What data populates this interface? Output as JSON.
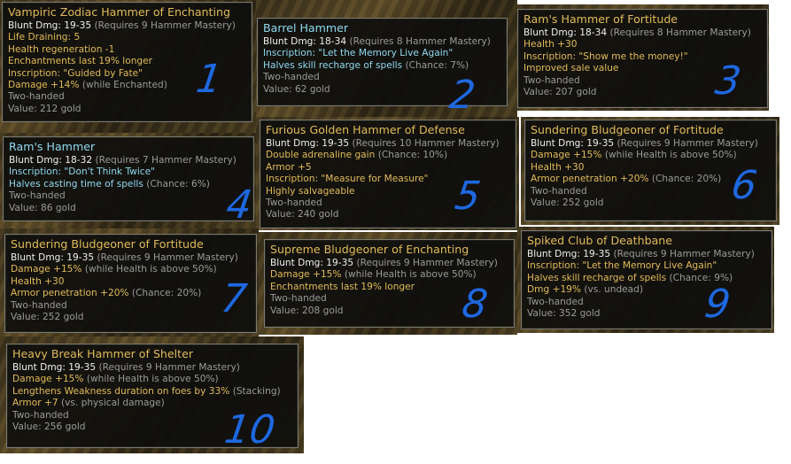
{
  "tooltips": [
    {
      "name": "Vampiric Zodiac Hammer of Enchanting",
      "lines": [
        {
          "parts": [
            {
              "t": "Blunt Dmg: 19-35 ",
              "c": "white"
            },
            {
              "t": "(Requires 9 Hammer Mastery)",
              "c": "gray"
            }
          ]
        },
        {
          "parts": [
            {
              "t": "Life Draining: 5",
              "c": "gold"
            }
          ]
        },
        {
          "parts": [
            {
              "t": "Health regeneration -1",
              "c": "gold"
            }
          ]
        },
        {
          "parts": [
            {
              "t": "Enchantments last 19% longer",
              "c": "gold"
            }
          ]
        },
        {
          "parts": [
            {
              "t": "Inscription: \"Guided by Fate\"",
              "c": "gold"
            }
          ]
        },
        {
          "parts": [
            {
              "t": "Damage +14% ",
              "c": "gold"
            },
            {
              "t": "(while Enchanted)",
              "c": "gray"
            }
          ]
        },
        {
          "parts": [
            {
              "t": "Two-handed",
              "c": "gray"
            }
          ]
        },
        {
          "parts": [
            {
              "t": "Value: 212 gold",
              "c": "gray"
            }
          ]
        }
      ]
    },
    {
      "name": "Barrel Hammer",
      "lines": [
        {
          "parts": [
            {
              "t": "Blunt Dmg: 18-34 ",
              "c": "white"
            },
            {
              "t": "(Requires 8 Hammer Mastery)",
              "c": "gray"
            }
          ]
        },
        {
          "parts": [
            {
              "t": "Inscription: \"Let the Memory Live Again\"",
              "c": "cyan"
            }
          ]
        },
        {
          "parts": [
            {
              "t": "Halves skill recharge of spells ",
              "c": "cyan"
            },
            {
              "t": "(Chance: 7%)",
              "c": "gray"
            }
          ]
        },
        {
          "parts": [
            {
              "t": "Two-handed",
              "c": "gray"
            }
          ]
        },
        {
          "parts": [
            {
              "t": "Value: 62 gold",
              "c": "gray"
            }
          ]
        }
      ]
    },
    {
      "name": "Ram's Hammer of Fortitude",
      "lines": [
        {
          "parts": [
            {
              "t": "Blunt Dmg: 18-34 ",
              "c": "white"
            },
            {
              "t": "(Requires 8 Hammer Mastery)",
              "c": "gray"
            }
          ]
        },
        {
          "parts": [
            {
              "t": "Health +30",
              "c": "gold"
            }
          ]
        },
        {
          "parts": [
            {
              "t": "Inscription: \"Show me the money!\"",
              "c": "gold"
            }
          ]
        },
        {
          "parts": [
            {
              "t": "Improved sale value",
              "c": "gold"
            }
          ]
        },
        {
          "parts": [
            {
              "t": "Two-handed",
              "c": "gray"
            }
          ]
        },
        {
          "parts": [
            {
              "t": "Value: 207 gold",
              "c": "gray"
            }
          ]
        }
      ]
    },
    {
      "name": "Ram's Hammer",
      "lines": [
        {
          "parts": [
            {
              "t": "Blunt Dmg: 18-32 ",
              "c": "white"
            },
            {
              "t": "(Requires 7 Hammer Mastery)",
              "c": "gray"
            }
          ]
        },
        {
          "parts": [
            {
              "t": "Inscription: \"Don't Think Twice\"",
              "c": "cyan"
            }
          ]
        },
        {
          "parts": [
            {
              "t": "Halves casting time of spells ",
              "c": "cyan"
            },
            {
              "t": "(Chance: 6%)",
              "c": "gray"
            }
          ]
        },
        {
          "parts": [
            {
              "t": "Two-handed",
              "c": "gray"
            }
          ]
        },
        {
          "parts": [
            {
              "t": "Value: 86 gold",
              "c": "gray"
            }
          ]
        }
      ]
    },
    {
      "name": "Furious Golden Hammer of Defense",
      "lines": [
        {
          "parts": [
            {
              "t": "Blunt Dmg: 19-35 ",
              "c": "white"
            },
            {
              "t": "(Requires 10 Hammer Mastery)",
              "c": "gray"
            }
          ]
        },
        {
          "parts": [
            {
              "t": "Double adrenaline gain ",
              "c": "gold"
            },
            {
              "t": "(Chance: 10%)",
              "c": "gray"
            }
          ]
        },
        {
          "parts": [
            {
              "t": "Armor +5",
              "c": "gold"
            }
          ]
        },
        {
          "parts": [
            {
              "t": "Inscription: \"Measure for Measure\"",
              "c": "gold"
            }
          ]
        },
        {
          "parts": [
            {
              "t": "Highly salvageable",
              "c": "gold"
            }
          ]
        },
        {
          "parts": [
            {
              "t": "Two-handed",
              "c": "gray"
            }
          ]
        },
        {
          "parts": [
            {
              "t": "Value: 240 gold",
              "c": "gray"
            }
          ]
        }
      ]
    },
    {
      "name": "Sundering Bludgeoner of Fortitude",
      "lines": [
        {
          "parts": [
            {
              "t": "Blunt Dmg: 19-35 ",
              "c": "white"
            },
            {
              "t": "(Requires 9 Hammer Mastery)",
              "c": "gray"
            }
          ]
        },
        {
          "parts": [
            {
              "t": "Damage +15% ",
              "c": "gold"
            },
            {
              "t": "(while Health is above 50%)",
              "c": "gray"
            }
          ]
        },
        {
          "parts": [
            {
              "t": "Health +30",
              "c": "gold"
            }
          ]
        },
        {
          "parts": [
            {
              "t": "Armor penetration +20% ",
              "c": "gold"
            },
            {
              "t": "(Chance: 20%)",
              "c": "gray"
            }
          ]
        },
        {
          "parts": [
            {
              "t": "Two-handed",
              "c": "gray"
            }
          ]
        },
        {
          "parts": [
            {
              "t": "Value: 252 gold",
              "c": "gray"
            }
          ]
        }
      ]
    },
    {
      "name": "Sundering Bludgeoner of Fortitude",
      "lines": [
        {
          "parts": [
            {
              "t": "Blunt Dmg: 19-35 ",
              "c": "white"
            },
            {
              "t": "(Requires 9 Hammer Mastery)",
              "c": "gray"
            }
          ]
        },
        {
          "parts": [
            {
              "t": "Damage +15% ",
              "c": "gold"
            },
            {
              "t": "(while Health is above 50%)",
              "c": "gray"
            }
          ]
        },
        {
          "parts": [
            {
              "t": "Health +30",
              "c": "gold"
            }
          ]
        },
        {
          "parts": [
            {
              "t": "Armor penetration +20% ",
              "c": "gold"
            },
            {
              "t": "(Chance: 20%)",
              "c": "gray"
            }
          ]
        },
        {
          "parts": [
            {
              "t": "Two-handed",
              "c": "gray"
            }
          ]
        },
        {
          "parts": [
            {
              "t": "Value: 252 gold",
              "c": "gray"
            }
          ]
        }
      ]
    },
    {
      "name": "Supreme Bludgeoner of Enchanting",
      "lines": [
        {
          "parts": [
            {
              "t": "Blunt Dmg: 19-35 ",
              "c": "white"
            },
            {
              "t": "(Requires 9 Hammer Mastery)",
              "c": "gray"
            }
          ]
        },
        {
          "parts": [
            {
              "t": "Damage +15% ",
              "c": "gold"
            },
            {
              "t": "(while Health is above 50%)",
              "c": "gray"
            }
          ]
        },
        {
          "parts": [
            {
              "t": "Enchantments last 19% longer",
              "c": "gold"
            }
          ]
        },
        {
          "parts": [
            {
              "t": "Two-handed",
              "c": "gray"
            }
          ]
        },
        {
          "parts": [
            {
              "t": "Value: 208 gold",
              "c": "gray"
            }
          ]
        }
      ]
    },
    {
      "name": "Spiked Club of Deathbane",
      "lines": [
        {
          "parts": [
            {
              "t": "Blunt Dmg: 19-35 ",
              "c": "white"
            },
            {
              "t": "(Requires 9 Hammer Mastery)",
              "c": "gray"
            }
          ]
        },
        {
          "parts": [
            {
              "t": "Inscription: \"Let the Memory Live Again\"",
              "c": "gold"
            }
          ]
        },
        {
          "parts": [
            {
              "t": "Halves skill recharge of spells ",
              "c": "gold"
            },
            {
              "t": "(Chance: 9%)",
              "c": "gray"
            }
          ]
        },
        {
          "parts": [
            {
              "t": "Dmg +19% ",
              "c": "gold"
            },
            {
              "t": "(vs. undead)",
              "c": "gray"
            }
          ]
        },
        {
          "parts": [
            {
              "t": "Two-handed",
              "c": "gray"
            }
          ]
        },
        {
          "parts": [
            {
              "t": "Value: 352 gold",
              "c": "gray"
            }
          ]
        }
      ]
    },
    {
      "name": "Heavy Break Hammer of Shelter",
      "lines": [
        {
          "parts": [
            {
              "t": "Blunt Dmg: 19-35 ",
              "c": "white"
            },
            {
              "t": "(Requires 9 Hammer Mastery)",
              "c": "gray"
            }
          ]
        },
        {
          "parts": [
            {
              "t": "Damage +15% ",
              "c": "gold"
            },
            {
              "t": "(while Health is above 50%)",
              "c": "gray"
            }
          ]
        },
        {
          "parts": [
            {
              "t": "Lengthens Weakness duration on foes by 33% ",
              "c": "gold"
            },
            {
              "t": "(Stacking)",
              "c": "gray"
            }
          ]
        },
        {
          "parts": [
            {
              "t": "Armor +7 ",
              "c": "gold"
            },
            {
              "t": "(vs. physical damage)",
              "c": "gray"
            }
          ]
        },
        {
          "parts": [
            {
              "t": "Two-handed",
              "c": "gray"
            }
          ]
        },
        {
          "parts": [
            {
              "t": "Value: 256 gold",
              "c": "gray"
            }
          ]
        }
      ]
    }
  ],
  "annotations": [
    "1",
    "2",
    "3",
    "4",
    "5",
    "6",
    "7",
    "8",
    "9",
    "10"
  ],
  "colors": {
    "title_gold": "#e2bb5a",
    "title_cyan": "#8fd9f0",
    "stat_white": "#efefef",
    "note_gray": "#9a9a9a",
    "annotation_blue": "#1e68e0"
  },
  "title_color": [
    "gold",
    "cyan",
    "gold",
    "cyan",
    "gold",
    "gold",
    "gold",
    "gold",
    "gold",
    "gold"
  ]
}
